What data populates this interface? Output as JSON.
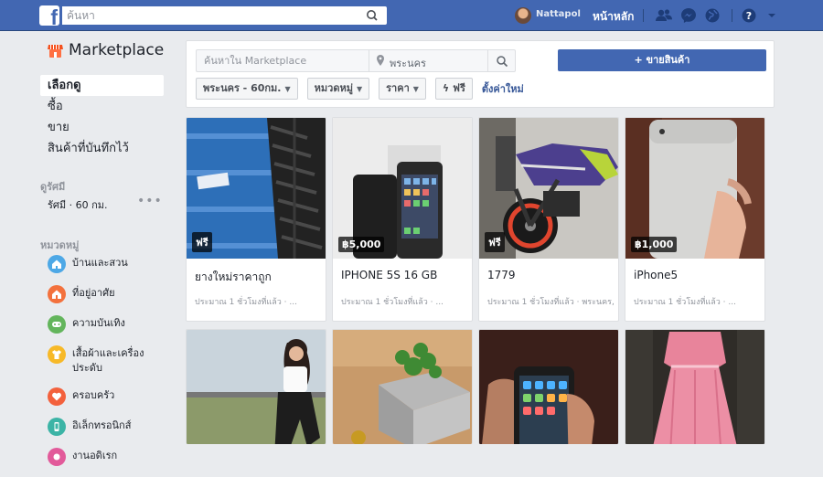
{
  "topbar": {
    "search_placeholder": "ค้นหา",
    "user_name": "Nattapol",
    "home_label": "หน้าหลัก"
  },
  "sidebar": {
    "title": "Marketplace",
    "nav": [
      {
        "label": "เลือกดู",
        "active": true
      },
      {
        "label": "ซื้อ"
      },
      {
        "label": "ขาย"
      },
      {
        "label": "สินค้าที่บันทึกไว้"
      }
    ],
    "location_heading": "ดูรัศมี",
    "location_value": "รัศมี · 60 กม.",
    "categories_heading": "หมวดหมู่",
    "categories": [
      {
        "label": "บ้านและสวน",
        "icon": "home-garden-icon",
        "color": "#4da8e6"
      },
      {
        "label": "ที่อยู่อาศัย",
        "icon": "housing-icon",
        "color": "#f3713d"
      },
      {
        "label": "ความบันเทิง",
        "icon": "entertainment-icon",
        "color": "#63b55c"
      },
      {
        "label": "เสื้อผ้าและเครื่องประดับ",
        "icon": "clothing-icon",
        "color": "#f7b928"
      },
      {
        "label": "ครอบครัว",
        "icon": "family-icon",
        "color": "#f3613d"
      },
      {
        "label": "อิเล็กทรอนิกส์",
        "icon": "electronics-icon",
        "color": "#3cb4a6"
      },
      {
        "label": "งานอดิเรก",
        "icon": "hobbies-icon",
        "color": "#e25a9a"
      }
    ]
  },
  "filter_panel": {
    "search_placeholder": "ค้นหาใน Marketplace",
    "location": "พระนคร",
    "sell_button": "+ ขายสินค้า",
    "filters": [
      {
        "label": "พระนคร - 60กม.",
        "caret": true
      },
      {
        "label": "หมวดหมู่",
        "caret": true
      },
      {
        "label": "ราคา",
        "caret": true
      },
      {
        "label": "ฟรี",
        "icon": "lightning-icon"
      }
    ],
    "reset_label": "ตั้งค่าใหม่"
  },
  "listings": [
    {
      "price": "ฟรี",
      "title": "ยางใหม่ราคาถูก",
      "meta": "ประมาณ 1 ชั่วโมงที่แล้ว · ...",
      "image": "tire-image"
    },
    {
      "price": "฿5,000",
      "title": "IPHONE 5S 16 GB",
      "meta": "ประมาณ 1 ชั่วโมงที่แล้ว · ...",
      "image": "iphone-image"
    },
    {
      "price": "ฟรี",
      "title": "1779",
      "meta": "ประมาณ 1 ชั่วโมงที่แล้ว · พระนคร,",
      "image": "motorbike-image"
    },
    {
      "price": "฿1,000",
      "title": "iPhone5",
      "meta": "ประมาณ 1 ชั่วโมงที่แล้ว · ...",
      "image": "phone-back-image"
    },
    {
      "image": "woman-image"
    },
    {
      "image": "plant-image"
    },
    {
      "image": "phone-hand-image"
    },
    {
      "image": "pink-dress-image"
    }
  ],
  "colors": {
    "topbar": "#4267b2",
    "page_bg": "#e9ebee",
    "link": "#385898"
  }
}
